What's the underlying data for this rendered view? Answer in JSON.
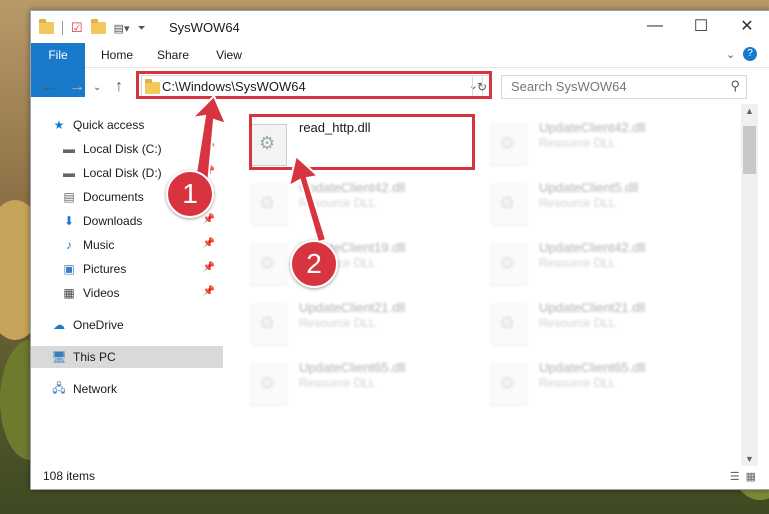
{
  "window": {
    "title": "SysWOW64"
  },
  "ribbon": {
    "tabs": [
      "File",
      "Home",
      "Share",
      "View"
    ]
  },
  "address": {
    "path": "C:\\Windows\\SysWOW64",
    "search_placeholder": "Search SysWOW64"
  },
  "sidebar": {
    "items": [
      {
        "label": "Quick access"
      },
      {
        "label": "Local Disk (C:)"
      },
      {
        "label": "Local Disk (D:)"
      },
      {
        "label": "Documents"
      },
      {
        "label": "Downloads"
      },
      {
        "label": "Music"
      },
      {
        "label": "Pictures"
      },
      {
        "label": "Videos"
      },
      {
        "label": "OneDrive"
      },
      {
        "label": "This PC"
      },
      {
        "label": "Network"
      }
    ]
  },
  "files": [
    {
      "name": "read_http.dll",
      "type": ""
    },
    {
      "name": "UpdateClient42.dll",
      "type": "Resource DLL"
    },
    {
      "name": "UpdateClient42.dll",
      "type": "Resource DLL"
    },
    {
      "name": "UpdateClient5.dll",
      "type": "Resource DLL"
    },
    {
      "name": "UpdateClient19.dll",
      "type": "Resource DLL"
    },
    {
      "name": "UpdateClient42.dll",
      "type": "Resource DLL"
    },
    {
      "name": "UpdateClient21.dll",
      "type": "Resource DLL"
    },
    {
      "name": "UpdateClient21.dll",
      "type": "Resource DLL"
    },
    {
      "name": "UpdateClient65.dll",
      "type": "Resource DLL"
    },
    {
      "name": "UpdateClient65.dll",
      "type": "Resource DLL"
    }
  ],
  "status": {
    "count": "108 items"
  },
  "annotations": {
    "step1": "1",
    "step2": "2",
    "color": "#d7343f"
  }
}
